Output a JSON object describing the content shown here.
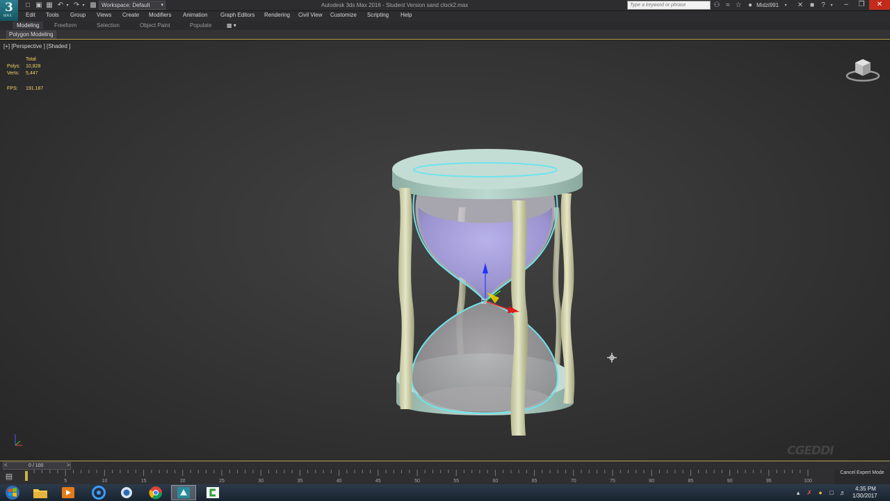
{
  "title_bar": {
    "app_logo_letter": "3",
    "app_logo_sub": "MAX",
    "workspace_label": "Workspace: Default",
    "window_title": "Autodesk 3ds Max 2016 - Student Version    sand clock2.max",
    "search_placeholder": "Type a keyword or phrase",
    "user_name": "Midzi991"
  },
  "menu": [
    "Edit",
    "Tools",
    "Group",
    "Views",
    "Create",
    "Modifiers",
    "Animation",
    "Graph Editors",
    "Rendering",
    "Civil View",
    "Customize",
    "Scripting",
    "Help"
  ],
  "ribbon": {
    "tabs": [
      "Modeling",
      "Freeform",
      "Selection",
      "Object Paint",
      "Populate"
    ],
    "active_tab": "Modeling",
    "panel_button": "Polygon Modeling"
  },
  "viewport": {
    "label": "[+] [Perspective ] [Shaded ]",
    "stats": {
      "header": "Total",
      "polys_label": "Polys:",
      "polys_value": "10,828",
      "verts_label": "Verts:",
      "verts_value": "5,447",
      "fps_label": "FPS:",
      "fps_value": "191.187"
    },
    "gizmo_axis_labels": {
      "z": "z",
      "x": "x",
      "y": "y"
    },
    "watermark": "CGEDDI"
  },
  "timeline": {
    "frame_readout": "0 / 100",
    "current_frame": 0,
    "total_frames": 100,
    "ticks": [
      5,
      10,
      15,
      20,
      25,
      30,
      35,
      40,
      45,
      50,
      55,
      60,
      65,
      70,
      75,
      80,
      85,
      90,
      95,
      100
    ],
    "cancel_expert_label": "Cancel Expert Mode"
  },
  "taskbar": {
    "clock_time": "4:35 PM",
    "clock_date": "1/30/2017"
  },
  "colors": {
    "accent_gold": "#b8a14a",
    "stats_text": "#f0d36a",
    "selection_outline": "#6fe3ee",
    "hourglass_mint": "#b8d6cc",
    "pillar_cream": "#d4d6b2",
    "sand_violet": "#9d96d3"
  }
}
